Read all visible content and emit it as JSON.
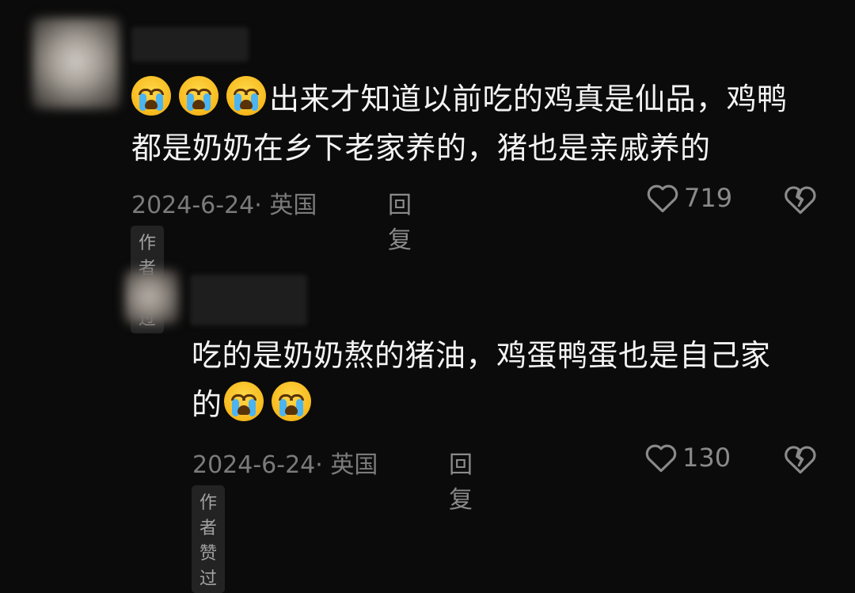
{
  "comments": [
    {
      "avatar": "blurred-avatar",
      "username_hidden": true,
      "emoji_prefix": [
        "crying-face",
        "crying-face",
        "crying-face"
      ],
      "text_line1": "出来才知道以前吃的鸡真是仙品，鸡鸭",
      "text_line2": "都是奶奶在乡下老家养的，猪也是亲戚养的",
      "date_location": "2024-6-24· 英国",
      "reply_label": "回复",
      "likes": "719",
      "badge": "作者赞过"
    },
    {
      "avatar": "blurred-avatar",
      "username_hidden": true,
      "text_line1": "吃的是奶奶熬的猪油，鸡蛋鸭蛋也是自己家",
      "text_line2": "的",
      "emoji_suffix": [
        "crying-face",
        "crying-face"
      ],
      "date_location": "2024-6-24· 英国",
      "reply_label": "回复",
      "likes": "130",
      "badge": "作者赞过"
    }
  ],
  "icons": {
    "like": "heart-outline-icon",
    "dislike": "broken-heart-icon"
  },
  "colors": {
    "background": "#0b0b0b",
    "text": "#f3f3f3",
    "meta": "#7b7b7b",
    "badge_bg": "#232323",
    "emoji": "#f7b91c"
  }
}
